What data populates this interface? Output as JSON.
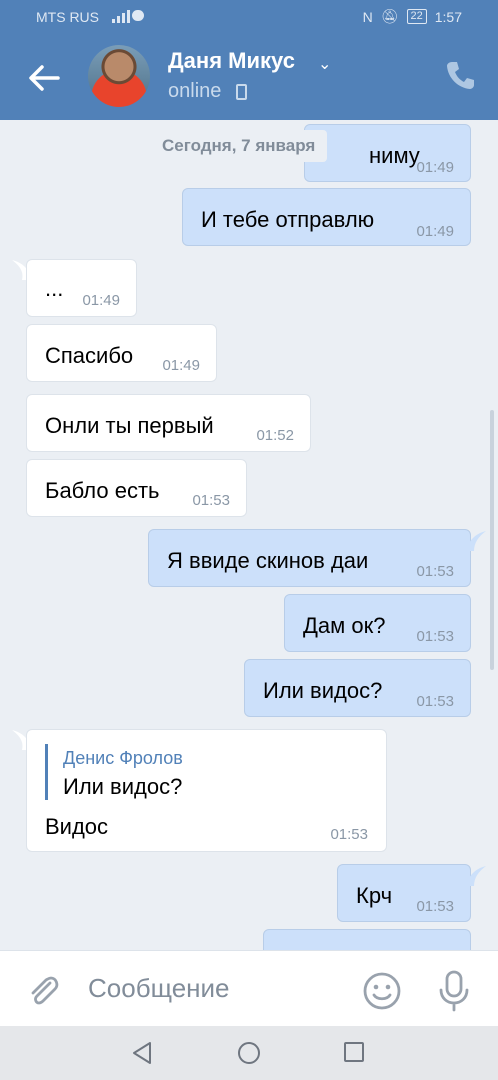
{
  "statusbar": {
    "carrier": "MTS RUS",
    "battery": "22",
    "time": "1:57"
  },
  "header": {
    "name": "Даня Микус",
    "status": "online"
  },
  "chat": {
    "date": "Сегодня, 7 января",
    "messages": [
      {
        "dir": "out",
        "text": "ниму",
        "time": "01:49"
      },
      {
        "dir": "out",
        "text": "И тебе отправлю",
        "time": "01:49"
      },
      {
        "dir": "in",
        "text": "...",
        "time": "01:49"
      },
      {
        "dir": "in",
        "text": "Спасибо",
        "time": "01:49"
      },
      {
        "dir": "in",
        "text": "Онли ты первый",
        "time": "01:52"
      },
      {
        "dir": "in",
        "text": "Бабло есть",
        "time": "01:53"
      },
      {
        "dir": "out",
        "text": "Я ввиде скинов даи",
        "time": "01:53"
      },
      {
        "dir": "out",
        "text": "Дам ок?",
        "time": "01:53"
      },
      {
        "dir": "out",
        "text": "Или видос?",
        "time": "01:53"
      },
      {
        "dir": "in",
        "reply_author": "Денис Фролов",
        "reply_text": "Или видос?",
        "text": "Видос",
        "time": "01:53"
      },
      {
        "dir": "out",
        "text": "Крч",
        "time": "01:53"
      }
    ]
  },
  "composer": {
    "placeholder": "Сообщение"
  },
  "colors": {
    "accent": "#5181b8",
    "outgoing": "#cce0fa",
    "incoming": "#ffffff",
    "background": "#ebeff4"
  }
}
